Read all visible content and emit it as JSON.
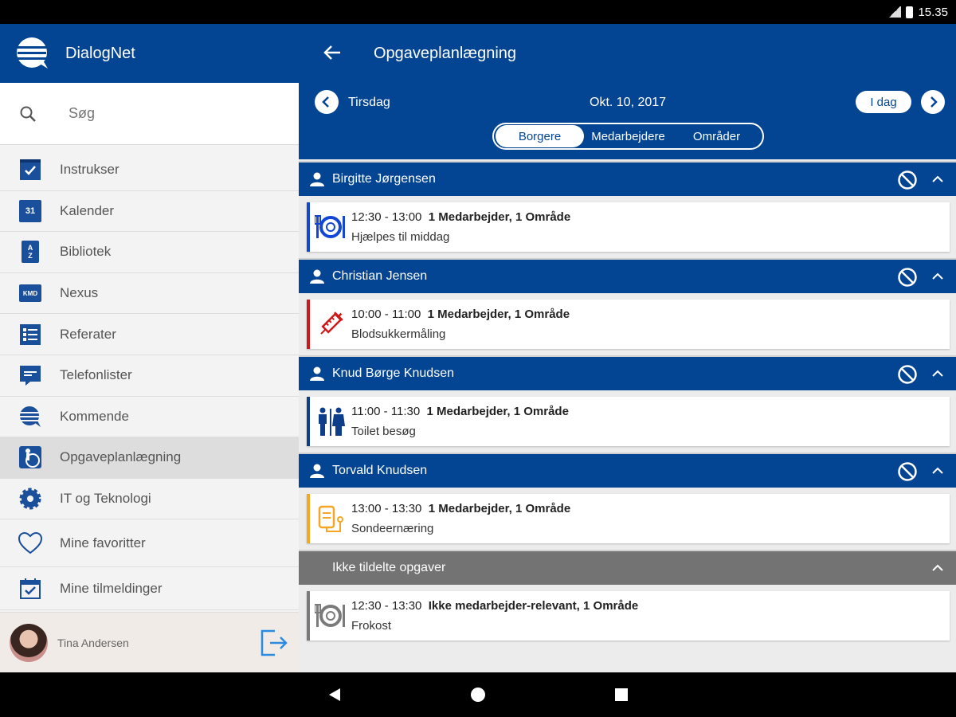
{
  "status_bar": {
    "time": "15.35"
  },
  "sidebar": {
    "app_name": "DialogNet",
    "search_placeholder": "Søg",
    "items": [
      {
        "label": "Instrukser",
        "icon": "checkbox-icon"
      },
      {
        "label": "Kalender",
        "icon": "calendar-31-icon"
      },
      {
        "label": "Bibliotek",
        "icon": "az-book-icon"
      },
      {
        "label": "Nexus",
        "icon": "kmd-icon"
      },
      {
        "label": "Referater",
        "icon": "list-document-icon"
      },
      {
        "label": "Telefonlister",
        "icon": "chat-bubble-icon"
      },
      {
        "label": "Kommende",
        "icon": "dialognet-logo-icon"
      },
      {
        "label": "Opgaveplanlægning",
        "icon": "care-person-icon"
      },
      {
        "label": "IT og Teknologi",
        "icon": "gear-icon"
      },
      {
        "label": "Mine favoritter",
        "icon": "heart-icon"
      },
      {
        "label": "Mine tilmeldinger",
        "icon": "calendar-check-icon"
      }
    ],
    "user_name": "Tina Andersen"
  },
  "main": {
    "title": "Opgaveplanlægning",
    "day": "Tirsdag",
    "date": "Okt. 10, 2017",
    "today_label": "I dag",
    "tabs": [
      "Borgere",
      "Medarbejdere",
      "Områder"
    ],
    "active_tab": "Borgere",
    "groups": [
      {
        "name": "Birgitte Jørgensen",
        "task": {
          "time": "12:30 - 13:00",
          "summary": "1 Medarbejder, 1 Område",
          "title": "Hjælpes til middag",
          "icon": "meal-icon",
          "color": "#1446d6"
        }
      },
      {
        "name": "Christian Jensen",
        "task": {
          "time": "10:00 - 11:00",
          "summary": "1 Medarbejder, 1 Område",
          "title": "Blodsukkermåling",
          "icon": "syringe-icon",
          "color": "#d01818"
        }
      },
      {
        "name": "Knud Børge Knudsen",
        "task": {
          "time": "11:00 - 11:30",
          "summary": "1 Medarbejder, 1 Område",
          "title": "Toilet besøg",
          "icon": "toilet-icon",
          "color": "#0e3e8a"
        }
      },
      {
        "name": "Torvald Knudsen",
        "task": {
          "time": "13:00 - 13:30",
          "summary": "1 Medarbejder, 1 Område",
          "title": "Sondeernæring",
          "icon": "iv-bag-icon",
          "color": "#f5a623"
        }
      }
    ],
    "unassigned": {
      "name": "Ikke tildelte opgaver",
      "task": {
        "time": "12:30 - 13:30",
        "summary": "Ikke medarbejder-relevant, 1 Område",
        "title": "Frokost",
        "icon": "meal-icon",
        "color": "#7a7a7a"
      }
    }
  }
}
